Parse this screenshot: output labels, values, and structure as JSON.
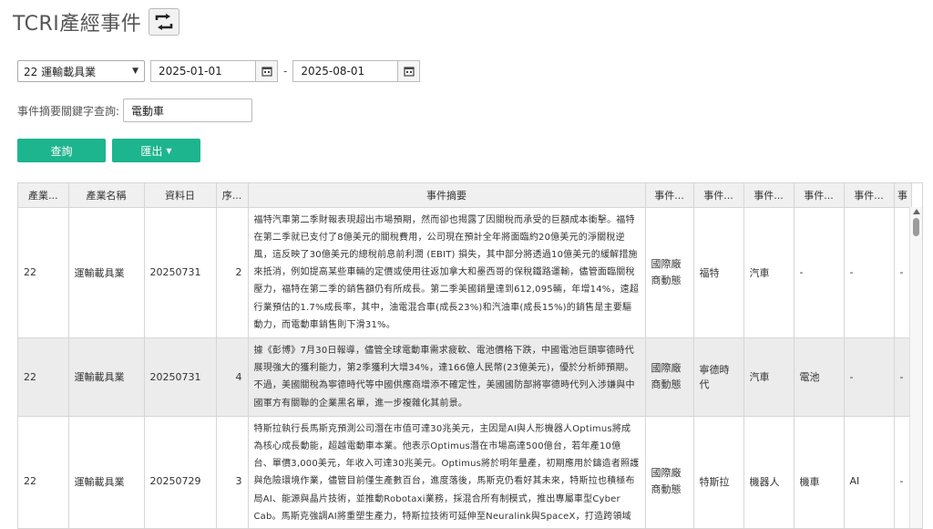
{
  "page": {
    "title": "TCRI產經事件"
  },
  "filters": {
    "industry_select": "22 運輸載具業",
    "date_from": "2025-01-01",
    "date_to": "2025-08-01",
    "separator": "-",
    "keyword_label": "事件摘要關鍵字查詢:",
    "keyword_value": "電動車"
  },
  "buttons": {
    "query": "查詢",
    "export": "匯出"
  },
  "table": {
    "headers": [
      "產業...",
      "產業名稱",
      "資料日",
      "序...",
      "事件摘要",
      "事件...",
      "事件...",
      "事件...",
      "事件...",
      "事件...",
      "事"
    ],
    "rows": [
      {
        "code": "22",
        "industry": "運輸載具業",
        "date": "20250731",
        "seq": "2",
        "summary": "福特汽車第二季財報表現超出市場預期，然而卻也揭露了因關稅而承受的巨額成本衝擊。福特在第二季就已支付了8億美元的關稅費用，公司現在預計全年將面臨約20億美元的淨關稅逆風，這反映了30億美元的總稅前息前利潤 (EBIT) 損失，其中部分將透過10億美元的緩解措施來抵消，例如提高某些車輛的定價或使用往返加拿大和墨西哥的保稅鐵路運輸，儘管面臨關稅壓力，福特在第二季的銷售額仍有所成長。第二季美國銷量達到612,095輛，年增14%，遠超行業預估的1.7%成長率，其中，油電混合車(成長23%)和汽油車(成長15%)的銷售是主要驅動力，而電動車銷售則下滑31%。",
        "type": "國際廠商動態",
        "company": "福特",
        "product": "汽車",
        "tag1": "-",
        "tag2": "-",
        "tag3": "-"
      },
      {
        "code": "22",
        "industry": "運輸載具業",
        "date": "20250731",
        "seq": "4",
        "summary": "據《彭博》7月30日報導，儘管全球電動車需求疲軟、電池價格下跌，中國電池巨頭寧德時代展現強大的獲利能力，第2季獲利大增34%，達166億人民幣(23億美元)，優於分析師預期。不過，美國關稅為寧德時代等中國供應商增添不確定性，美國國防部將寧德時代列入涉嫌與中國軍方有關聯的企業黑名單，進一步複雜化其前景。",
        "type": "國際廠商動態",
        "company": "寧德時代",
        "product": "汽車",
        "tag1": "電池",
        "tag2": "-",
        "tag3": "-"
      },
      {
        "code": "22",
        "industry": "運輸載具業",
        "date": "20250729",
        "seq": "3",
        "summary": "特斯拉執行長馬斯克預測公司潛在市值可達30兆美元，主因是AI與人形機器人Optimus將成為核心成長動能，超越電動車本業。他表示Optimus潛在市場高達500億台，若年產10億台、單價3,000美元，年收入可達30兆美元。Optimus將於明年量產，初期應用於鑄造者照護與危險環境作業，儘管目前僅生產數百台，進度落後，馬斯克仍看好其未來，特斯拉也積極布局AI、能源與晶片技術，並推動Robotaxi業務，採混合所有制模式，推出專屬車型Cyber Cab。馬斯克強調AI將重塑生產力，特斯拉技術可延伸至Neuralink與SpaceX，打造跨領域整合平台。",
        "type": "國際廠商動態",
        "company": "特斯拉",
        "product": "機器人",
        "tag1": "機車",
        "tag2": "AI",
        "tag3": "-"
      }
    ]
  },
  "icons": {
    "refresh": "refresh-arrows-icon",
    "calendar": "calendar-icon"
  },
  "colors": {
    "accent": "#1db58e",
    "row_alt": "#ececec"
  }
}
